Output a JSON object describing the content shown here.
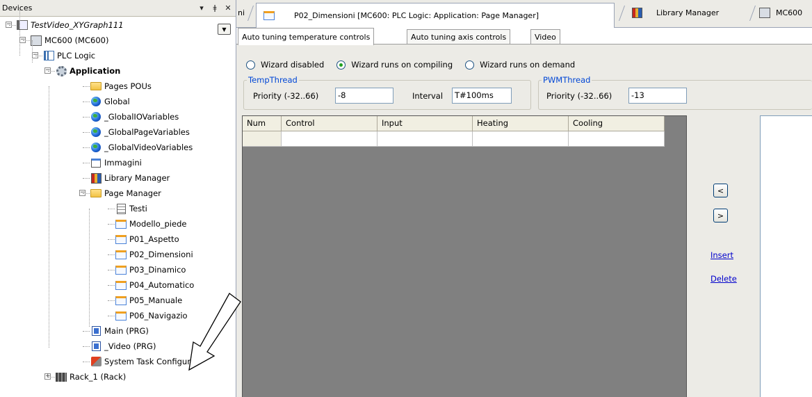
{
  "devices_panel": {
    "title": "Devices",
    "pin_glyph": "▾",
    "pushpin_glyph": "ǂ",
    "close_glyph": "✕",
    "dropdown_glyph": "▼"
  },
  "tree": [
    {
      "label": "TestVideo_XYGraph111",
      "icon": "project-icon",
      "expander": "−",
      "italic": true
    },
    {
      "label": "MC600 (MC600)",
      "icon": "device-icon",
      "expander": "−"
    },
    {
      "label": "PLC Logic",
      "icon": "plc-logic-icon",
      "expander": "−"
    },
    {
      "label": "Application",
      "icon": "gear-icon",
      "expander": "−",
      "bold": true
    },
    {
      "label": "Pages POUs",
      "icon": "folder-icon"
    },
    {
      "label": "Global",
      "icon": "globe-icon"
    },
    {
      "label": "_GlobalIOVariables",
      "icon": "globe-icon"
    },
    {
      "label": "_GlobalPageVariables",
      "icon": "globe-icon"
    },
    {
      "label": "_GlobalVideoVariables",
      "icon": "globe-icon"
    },
    {
      "label": "Immagini",
      "icon": "image-pool-icon"
    },
    {
      "label": "Library Manager",
      "icon": "library-books-icon"
    },
    {
      "label": "Page Manager",
      "icon": "page-manager-icon",
      "expander": "−"
    },
    {
      "label": "Testi",
      "icon": "text-list-icon"
    },
    {
      "label": "Modello_piede",
      "icon": "page-icon"
    },
    {
      "label": "P01_Aspetto",
      "icon": "page-icon"
    },
    {
      "label": "P02_Dimensioni",
      "icon": "page-icon"
    },
    {
      "label": "P03_Dinamico",
      "icon": "page-icon"
    },
    {
      "label": "P04_Automatico",
      "icon": "page-icon"
    },
    {
      "label": "P05_Manuale",
      "icon": "page-icon"
    },
    {
      "label": "P06_Navigazio",
      "icon": "page-icon"
    },
    {
      "label": "Main (PRG)",
      "icon": "program-icon"
    },
    {
      "label": "_Video (PRG)",
      "icon": "program-icon"
    },
    {
      "label": "System Task Configurati",
      "icon": "task-config-icon"
    },
    {
      "label": "Rack_1 (Rack)",
      "icon": "rack-icon",
      "expander": "+"
    }
  ],
  "doc_tabs": {
    "partial_left": "ni",
    "active": "P02_Dimensioni [MC600: PLC Logic: Application: Page Manager]",
    "library": "Library Manager",
    "mc600": "MC600"
  },
  "inner_tabs": [
    "Auto tuning temperature controls",
    "Auto tuning axis controls",
    "Video"
  ],
  "wizard": {
    "options": [
      {
        "label": "Wizard disabled",
        "selected": false
      },
      {
        "label": "Wizard runs on compiling",
        "selected": true
      },
      {
        "label": "Wizard runs on demand",
        "selected": false
      }
    ]
  },
  "temp_thread": {
    "legend": "TempThread",
    "priority_label": "Priority (-32..66)",
    "priority_value": "-8",
    "interval_label": "Interval",
    "interval_value": "T#100ms"
  },
  "pwm_thread": {
    "legend": "PWMThread",
    "priority_label": "Priority (-32..66)",
    "priority_value": "-13"
  },
  "grid": {
    "columns": [
      "Num",
      "Control",
      "Input",
      "Heating",
      "Cooling"
    ],
    "rows": [
      [
        "",
        "",
        "",
        "",
        ""
      ]
    ]
  },
  "side_buttons": {
    "left": "<",
    "right": ">",
    "insert": "Insert",
    "delete": "Delete"
  },
  "colors": {
    "legend_blue": "#0046d5",
    "link_blue": "#0000cc",
    "grid_bg": "#808080",
    "radio_selected": "#21a121"
  }
}
